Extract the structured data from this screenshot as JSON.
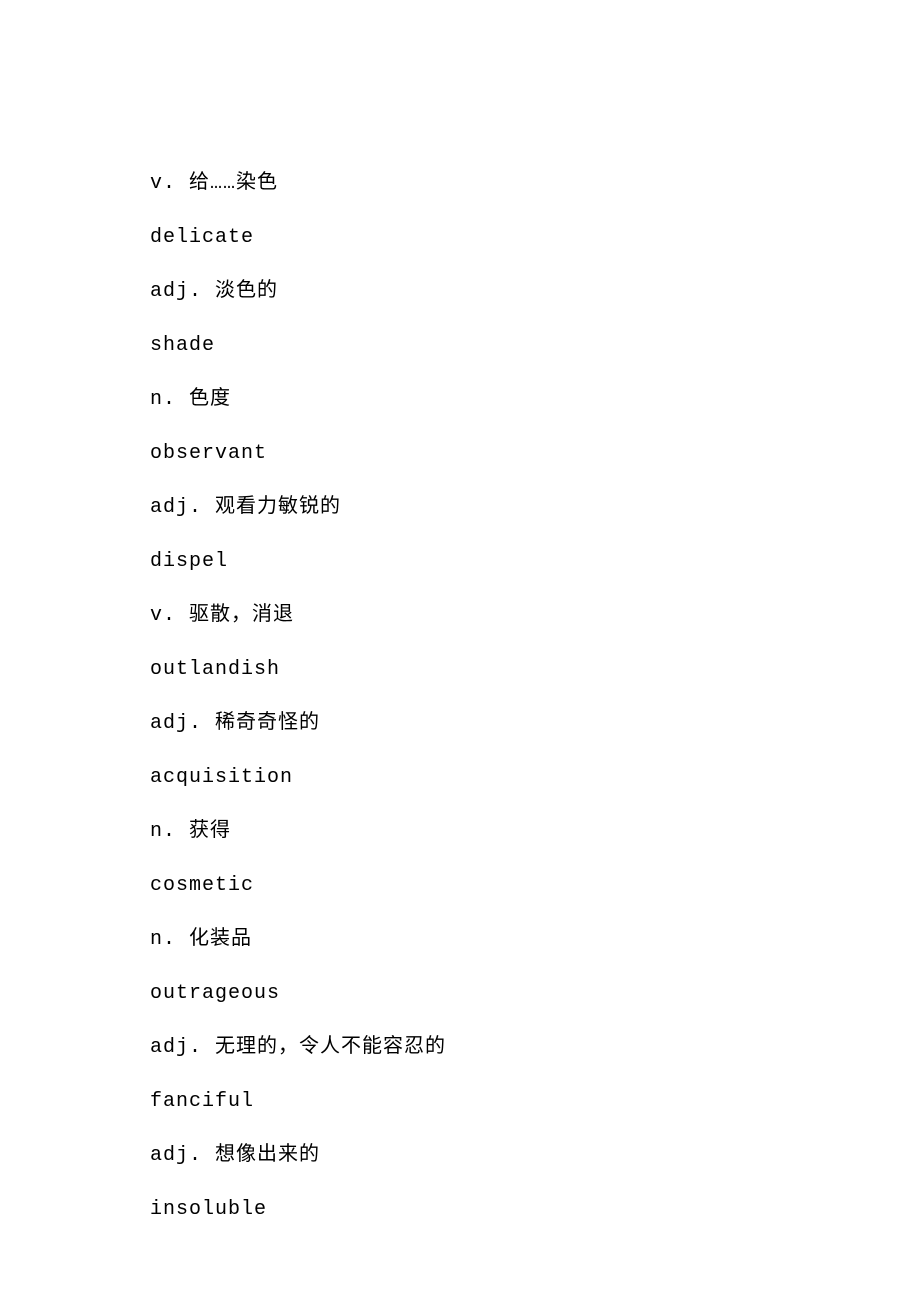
{
  "entries": [
    {
      "text": "v. 给……染色",
      "type": "def-line"
    },
    {
      "text": "delicate",
      "type": "english"
    },
    {
      "text": "adj. 淡色的",
      "type": "def-line"
    },
    {
      "text": "shade",
      "type": "english"
    },
    {
      "text": "n. 色度",
      "type": "def-line"
    },
    {
      "text": "observant",
      "type": "english"
    },
    {
      "text": "adj. 观看力敏锐的",
      "type": "def-line"
    },
    {
      "text": "dispel",
      "type": "english"
    },
    {
      "text": "v. 驱散，消退",
      "type": "def-line"
    },
    {
      "text": "outlandish",
      "type": "english"
    },
    {
      "text": "adj. 稀奇奇怪的",
      "type": "def-line"
    },
    {
      "text": "acquisition",
      "type": "english"
    },
    {
      "text": "n. 获得",
      "type": "def-line"
    },
    {
      "text": "cosmetic",
      "type": "english"
    },
    {
      "text": "n. 化装品",
      "type": "def-line"
    },
    {
      "text": "outrageous",
      "type": "english"
    },
    {
      "text": "adj. 无理的，令人不能容忍的",
      "type": "def-line"
    },
    {
      "text": "fanciful",
      "type": "english"
    },
    {
      "text": "adj. 想像出来的",
      "type": "def-line"
    },
    {
      "text": "insoluble",
      "type": "english"
    }
  ]
}
